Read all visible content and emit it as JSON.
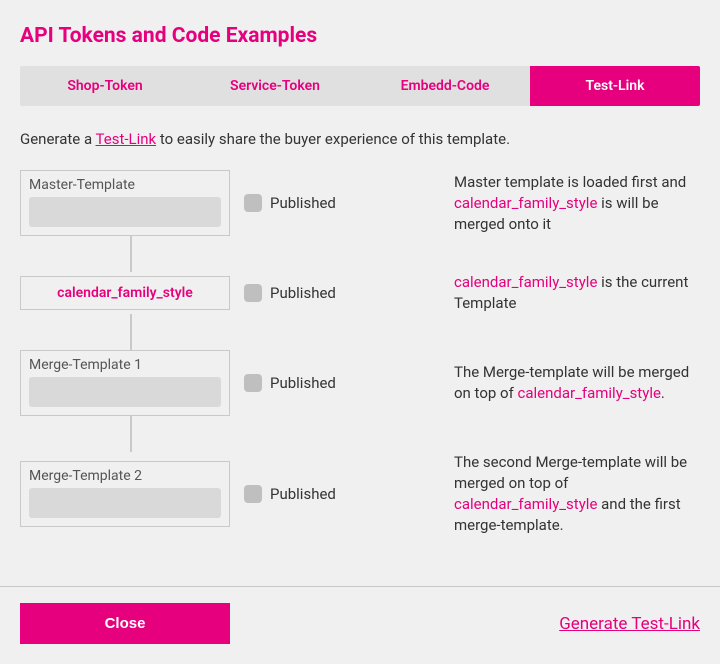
{
  "colors": {
    "accent": "#e6007e"
  },
  "title": "API Tokens and Code Examples",
  "tabs": [
    {
      "label": "Shop-Token",
      "active": false
    },
    {
      "label": "Service-Token",
      "active": false
    },
    {
      "label": "Embedd-Code",
      "active": false
    },
    {
      "label": "Test-Link",
      "active": true
    }
  ],
  "intro": {
    "prefix": "Generate a ",
    "link": "Test-Link",
    "suffix": " to easily share the buyer experience of this template."
  },
  "published_label": "Published",
  "template_name": "calendar_family_style",
  "rows": [
    {
      "card_label": "Master-Template",
      "card_is_current": false,
      "desc_pre": "Master template is loaded first and ",
      "desc_link": "calendar_family_style",
      "desc_post": " is will be merged onto it"
    },
    {
      "card_label": "calendar_family_style",
      "card_is_current": true,
      "desc_pre": "",
      "desc_link": "calendar_family_style",
      "desc_post": " is the current Template"
    },
    {
      "card_label": "Merge-Template 1",
      "card_is_current": false,
      "desc_pre": "The Merge-template will be merged on top of ",
      "desc_link": "calendar_family_style",
      "desc_post": "."
    },
    {
      "card_label": "Merge-Template 2",
      "card_is_current": false,
      "desc_pre": "The second Merge-template will be merged on top of ",
      "desc_link": "calendar_family_style",
      "desc_post": " and the first merge-template."
    }
  ],
  "footer": {
    "close": "Close",
    "generate": "Generate Test-Link"
  }
}
